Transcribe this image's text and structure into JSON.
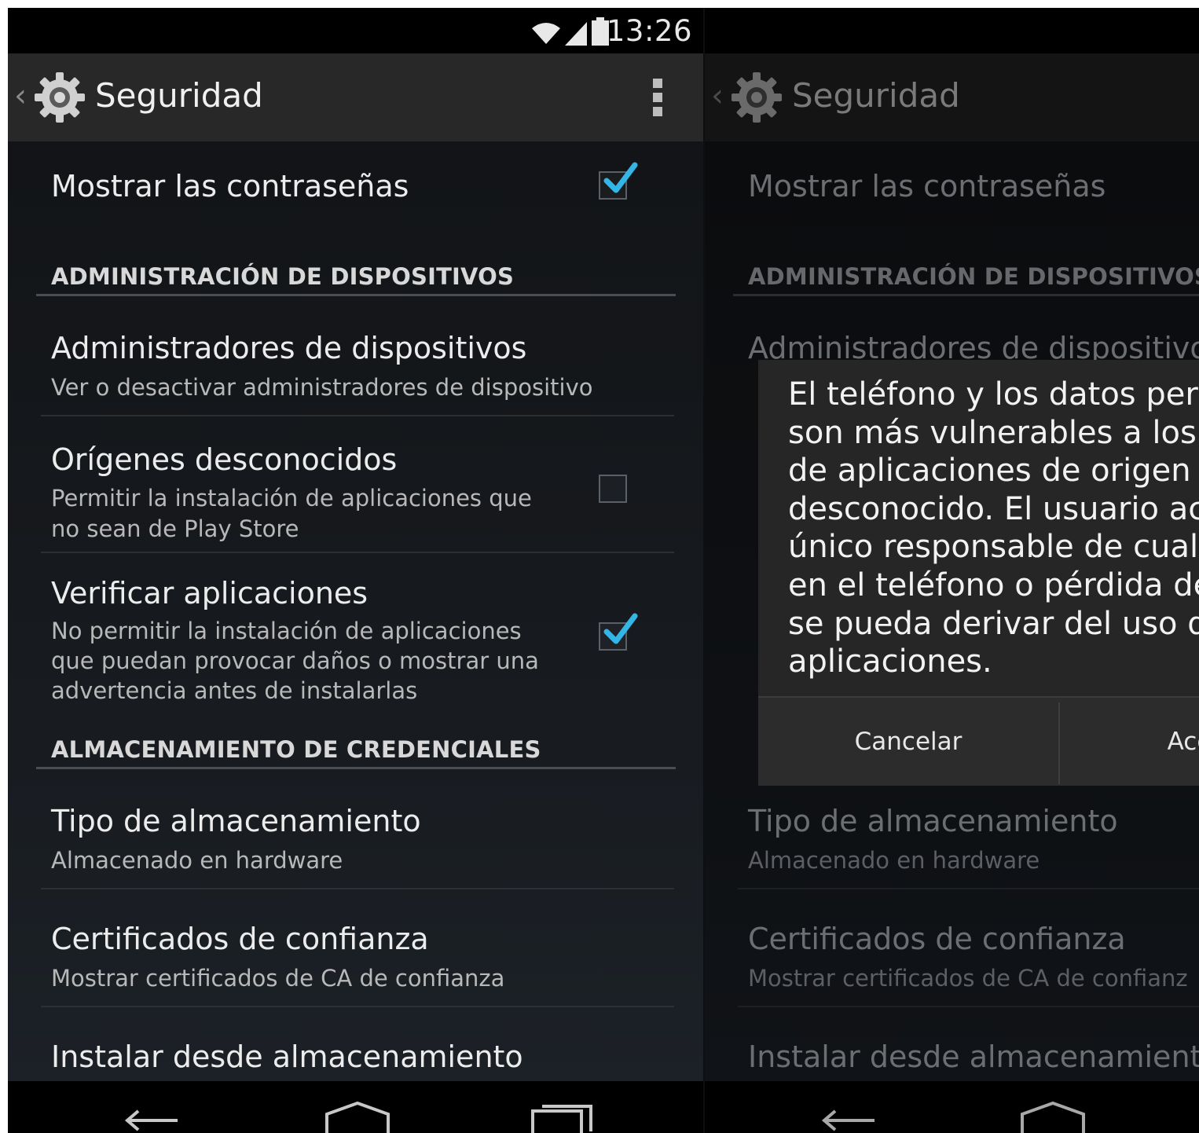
{
  "status_bar": {
    "time": "13:26",
    "icons": [
      "wifi-icon",
      "signal-icon",
      "battery-icon"
    ]
  },
  "action_bar": {
    "title": "Seguridad",
    "icons": [
      "chevron-left-icon",
      "gear-icon",
      "overflow-menu-icon"
    ]
  },
  "settings": {
    "show_passwords": {
      "title": "Mostrar las contraseñas",
      "checked": true
    },
    "device_admin_header": "ADMINISTRACIÓN DE DISPOSITIVOS",
    "device_admins": {
      "title": "Administradores de dispositivos",
      "summary": "Ver o desactivar administradores de dispositivo"
    },
    "unknown_sources": {
      "title": "Orígenes desconocidos",
      "summary": [
        "Permitir la instalación de aplicaciones que",
        "no sean de Play Store"
      ],
      "checked": false
    },
    "verify_apps": {
      "title": "Verificar aplicaciones",
      "summary": [
        "No permitir la instalación de aplicaciones",
        "que puedan provocar daños o mostrar una",
        "advertencia antes de instalarlas"
      ],
      "checked": true
    },
    "credential_header": "ALMACENAMIENTO DE CREDENCIALES",
    "storage_type": {
      "title": "Tipo de almacenamiento",
      "summary": "Almacenado en hardware"
    },
    "trusted_certs": {
      "title": "Certificados de confianza",
      "summary": "Mostrar certificados de CA de confianza"
    },
    "install_from_storage": {
      "title": "Instalar desde almacenamiento"
    }
  },
  "dialog": {
    "message": "El teléfono y los datos persor\nson más vulnerables a los at\nde aplicaciones de origen\ndesconocido. El usuario acep\núnico responsable de cualqu\nen el teléfono o pérdida de da\nse pueda derivar del uso de e\naplicaciones.",
    "cancel_label": "Cancelar",
    "accept_label": "Ace"
  },
  "right_panel_visible": {
    "trusted_certs_summary": "Mostrar certificados de CA de confianz",
    "device_admins_title": "Administradores de dispositivo"
  },
  "nav_bar": {
    "icons": [
      "back-icon",
      "home-icon",
      "recents-icon"
    ]
  },
  "colors": {
    "accent_check": "#33b5e5",
    "dialog_bg": "#262626",
    "action_bar": "#282828"
  }
}
